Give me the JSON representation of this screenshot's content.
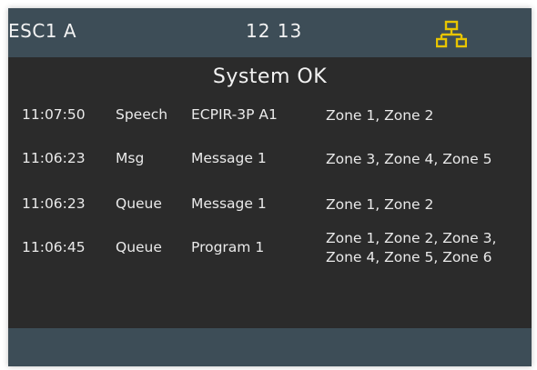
{
  "header": {
    "device_name": "ESC1 A",
    "clock": "12 13",
    "network_icon": "network-icon",
    "accent_color": "#e8c500"
  },
  "status": {
    "text": "System OK"
  },
  "events": [
    {
      "time": "11:07:50",
      "type": "Speech",
      "source": "ECPIR-3P A1",
      "zones_line1": "Zone 1, Zone 2",
      "zones_line2": ""
    },
    {
      "time": "11:06:23",
      "type": "Msg",
      "source": "Message 1",
      "zones_line1": "Zone 3, Zone 4, Zone 5",
      "zones_line2": ""
    },
    {
      "time": "11:06:23",
      "type": "Queue",
      "source": "Message 1",
      "zones_line1": "Zone 1, Zone 2",
      "zones_line2": ""
    },
    {
      "time": "11:06:45",
      "type": "Queue",
      "source": "Program 1",
      "zones_line1": "Zone 1, Zone 2, Zone 3,",
      "zones_line2": "Zone 4, Zone 5, Zone 6"
    }
  ],
  "colors": {
    "bar": "#3d4d57",
    "background": "#2b2b2b",
    "text": "#eaeaea"
  }
}
